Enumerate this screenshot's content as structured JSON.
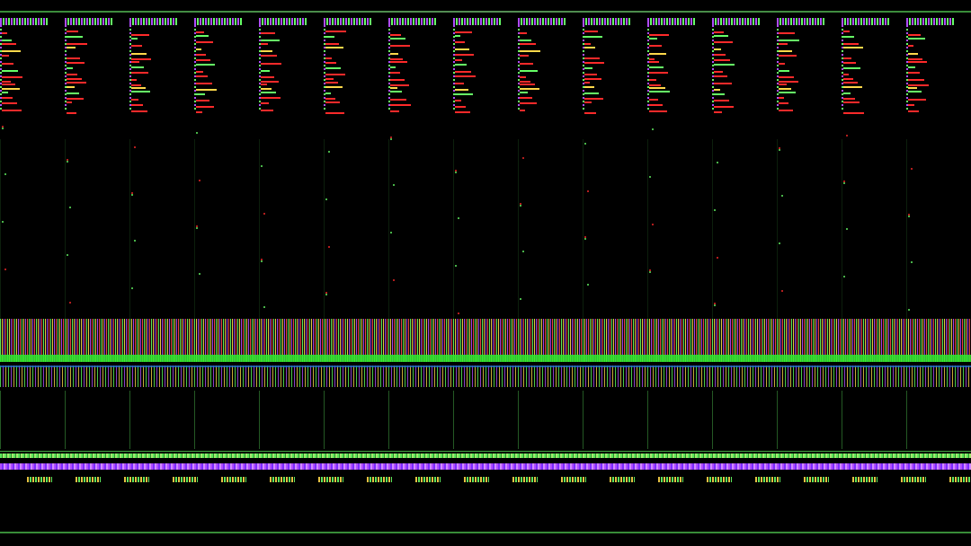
{
  "window": {
    "title": "",
    "columns": [
      {
        "label": ""
      },
      {
        "label": ""
      },
      {
        "label": ""
      },
      {
        "label": ""
      },
      {
        "label": ""
      },
      {
        "label": ""
      },
      {
        "label": ""
      },
      {
        "label": ""
      },
      {
        "label": ""
      },
      {
        "label": ""
      },
      {
        "label": ""
      },
      {
        "label": ""
      },
      {
        "label": ""
      },
      {
        "label": ""
      },
      {
        "label": ""
      }
    ]
  },
  "colors": {
    "background": "#000000",
    "accent_green": "#66ff66",
    "accent_purple": "#b04cff",
    "accent_red": "#ff2a2a",
    "accent_yellow": "#ffd84a",
    "accent_blue": "#2a8cff"
  }
}
